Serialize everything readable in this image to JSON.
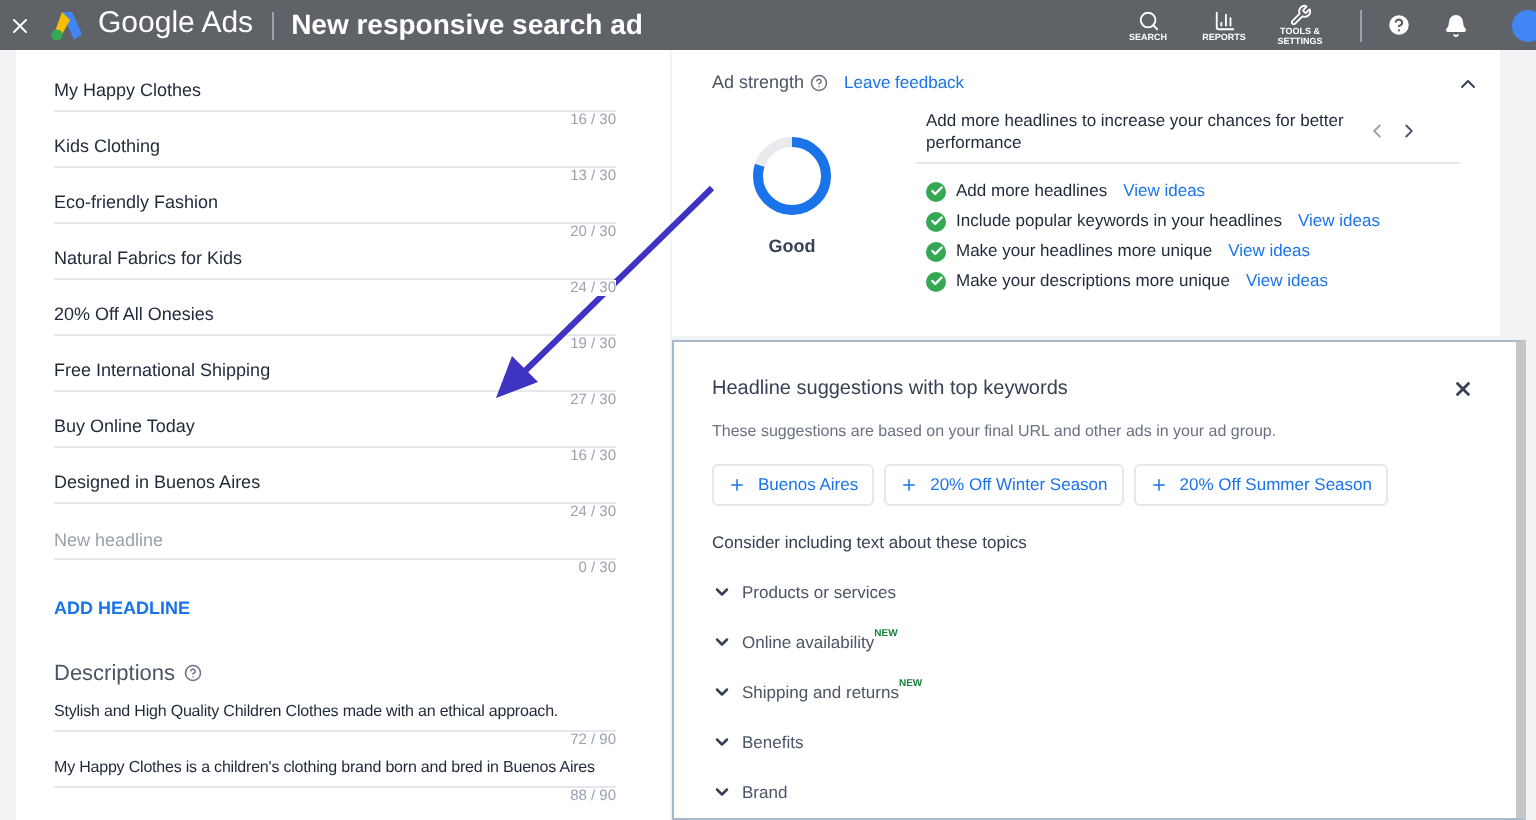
{
  "top_bar": {
    "brand": "Google Ads",
    "title": "New responsive search ad",
    "nav": [
      {
        "kind": "search",
        "label": "SEARCH"
      },
      {
        "kind": "reports",
        "label": "REPORTS"
      },
      {
        "kind": "tools",
        "label": "TOOLS &\nSETTINGS"
      }
    ]
  },
  "headlines": [
    {
      "value": "My Happy Clothes",
      "count": "16 / 30"
    },
    {
      "value": "Kids Clothing",
      "count": "13 / 30"
    },
    {
      "value": "Eco-friendly Fashion",
      "count": "20 / 30"
    },
    {
      "value": "Natural Fabrics for Kids",
      "count": "24 / 30"
    },
    {
      "value": "20% Off All Onesies",
      "count": "19 / 30"
    },
    {
      "value": "Free International Shipping",
      "count": "27 / 30"
    },
    {
      "value": "Buy Online Today",
      "count": "16 / 30"
    },
    {
      "value": "Designed in Buenos Aires",
      "count": "24 / 30"
    },
    {
      "placeholder": "New headline",
      "count": "0 / 30"
    }
  ],
  "add_headline": "ADD HEADLINE",
  "descriptions_title": "Descriptions",
  "descriptions": [
    {
      "value": "Stylish and High Quality Children Clothes made with an ethical approach.",
      "count": "72 / 90"
    },
    {
      "value": "My Happy Clothes is a children's clothing brand born and bred in Buenos Aires",
      "count": "88 / 90"
    }
  ],
  "ad_strength": {
    "title": "Ad strength",
    "feedback": "Leave feedback",
    "level": 0.8,
    "rating": "Good",
    "tip": "Add more headlines to increase your chances for better performance",
    "checklist": [
      {
        "text": "Add more headlines",
        "link": "View ideas",
        "checked": true
      },
      {
        "text": "Include popular keywords in your headlines",
        "link": "View ideas",
        "checked": true
      },
      {
        "text": "Make your headlines more unique",
        "link": "View ideas",
        "checked": true
      },
      {
        "text": "Make your descriptions more unique",
        "link": "View ideas",
        "checked": true
      }
    ]
  },
  "suggestions": {
    "title": "Headline suggestions with top keywords",
    "subtitle": "These suggestions are based on your final URL and other ads in your ad group.",
    "chips": [
      "Buenos Aires",
      "20% Off Winter Season",
      "20% Off Summer Season"
    ],
    "topics_title": "Consider including text about these topics",
    "topics": [
      {
        "label": "Products or services",
        "expanded": false
      },
      {
        "label": "Online availability",
        "badge": "NEW",
        "expanded": false
      },
      {
        "label": "Shipping and returns",
        "badge": "NEW",
        "expanded": false
      },
      {
        "label": "Benefits",
        "expanded": false
      },
      {
        "label": "Brand",
        "expanded": false
      }
    ]
  }
}
